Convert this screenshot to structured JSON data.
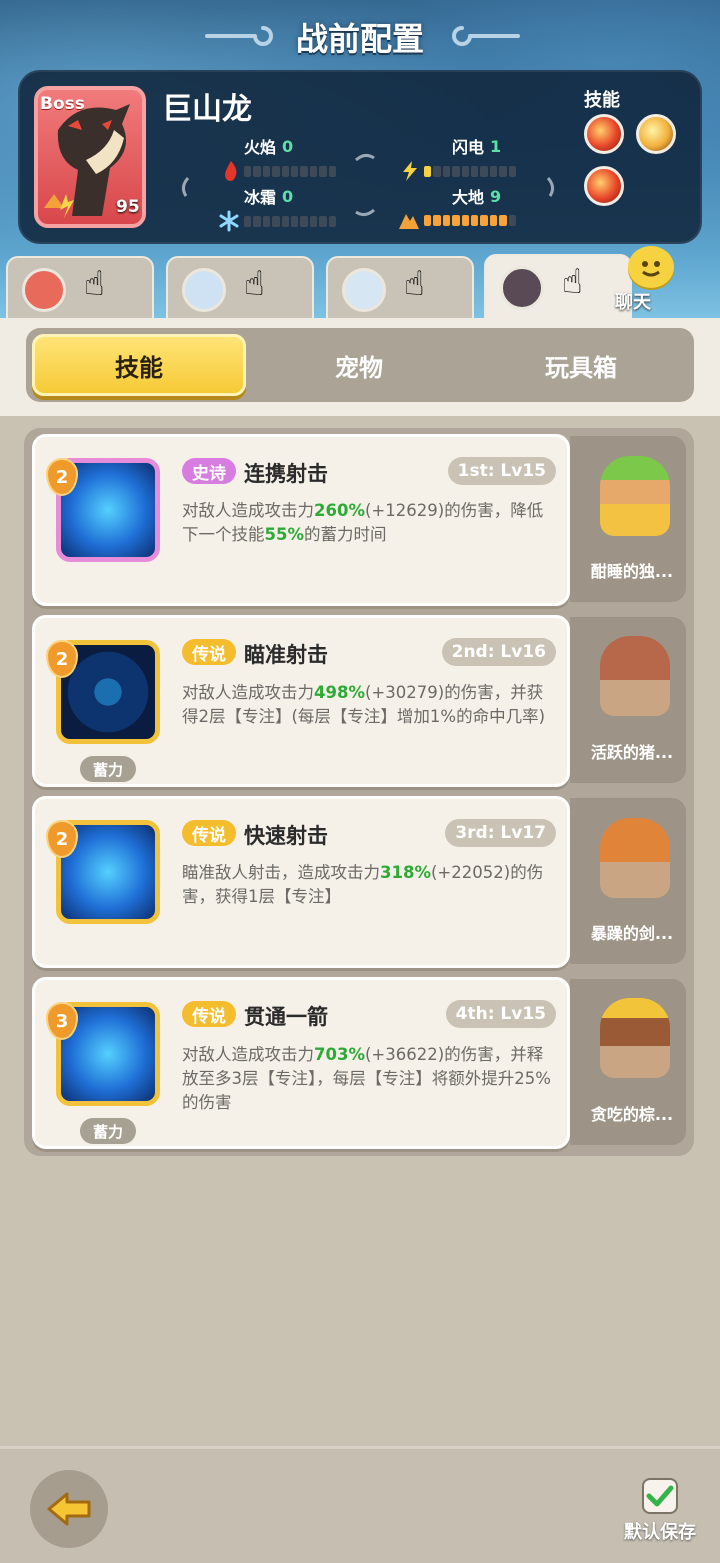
{
  "header": {
    "title": "战前配置"
  },
  "boss": {
    "tag": "Boss",
    "level": "95",
    "name": "巨山龙",
    "stats": [
      {
        "label": "火焰",
        "value": "0",
        "icon": "fire-icon"
      },
      {
        "label": "闪电",
        "value": "1",
        "icon": "lightning-icon"
      },
      {
        "label": "冰霜",
        "value": "0",
        "icon": "snowflake-icon"
      },
      {
        "label": "大地",
        "value": "9",
        "icon": "earth-icon"
      }
    ],
    "skills_label": "技能"
  },
  "heroes": {
    "tabs": [
      {
        "name": "hero-1",
        "active": false
      },
      {
        "name": "hero-2",
        "active": false
      },
      {
        "name": "hero-3",
        "active": false
      },
      {
        "name": "hero-4",
        "active": true
      }
    ],
    "chat_label": "聊天"
  },
  "tabs": {
    "skill": "技能",
    "pet": "宠物",
    "toy": "玩具箱",
    "active": "技能"
  },
  "skills": [
    {
      "rank": "2",
      "rarity": "史诗",
      "name": "连携射击",
      "slot": "1st: Lv15",
      "charge": "",
      "desc_pre": "对敌人造成攻击力",
      "pct": "260%",
      "bonus": "(+12629)",
      "desc_mid": "的伤害，降低下一个技能",
      "pct2": "55%",
      "desc_post": "的蓄力时间",
      "pet": "酣睡的独..."
    },
    {
      "rank": "2",
      "rarity": "传说",
      "name": "瞄准射击",
      "slot": "2nd: Lv16",
      "charge": "蓄力",
      "desc_pre": "对敌人造成攻击力",
      "pct": "498%",
      "bonus": "(+30279)",
      "desc_mid": "的伤害，并获得2层【专注】(每层【专注】增加1%的命中几率)",
      "pct2": "",
      "desc_post": "",
      "pet": "活跃的猪..."
    },
    {
      "rank": "2",
      "rarity": "传说",
      "name": "快速射击",
      "slot": "3rd: Lv17",
      "charge": "",
      "desc_pre": "瞄准敌人射击，造成攻击力",
      "pct": "318%",
      "bonus": "(+22052)",
      "desc_mid": "的伤害，获得1层【专注】",
      "pct2": "",
      "desc_post": "",
      "pet": "暴躁的剑..."
    },
    {
      "rank": "3",
      "rarity": "传说",
      "name": "贯通一箭",
      "slot": "4th: Lv15",
      "charge": "蓄力",
      "desc_pre": "对敌人造成攻击力",
      "pct": "703%",
      "bonus": "(+36622)",
      "desc_mid": "的伤害，并释放至多3层【专注】，每层【专注】将额外提升25%的伤害",
      "pct2": "",
      "desc_post": "",
      "pet": "贪吃的棕..."
    }
  ],
  "footer": {
    "save_label": "默认保存"
  },
  "colors": {
    "accent": "#f6c933",
    "highlight": "#2eaa36",
    "epic": "#d77ce0",
    "legend": "#f3bd2d"
  }
}
